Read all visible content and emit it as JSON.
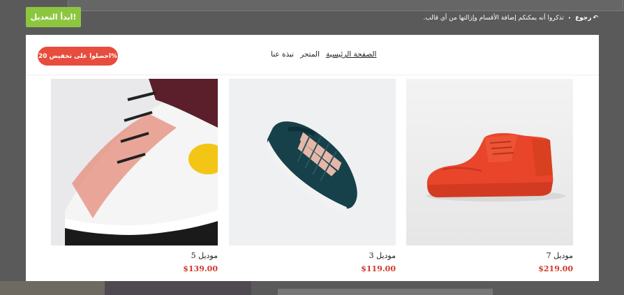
{
  "topbar": {
    "start_edit_label": "ابدأ التعديل!",
    "back_label": "رجوع",
    "note": "تذكروا أنه يمكنكم إضافة الأقسام وإزالتها من أي قالب."
  },
  "header": {
    "promo_label": "احصلوا على تخفيض 20%",
    "nav": [
      "الصفحة الرئيسية",
      "المتجر",
      "نبذة عنا"
    ]
  },
  "products": [
    {
      "title": "موديل 7",
      "price": "$219.00"
    },
    {
      "title": "موديل 3",
      "price": "$119.00"
    },
    {
      "title": "موديل 5",
      "price": "$139.00"
    }
  ],
  "colors": {
    "accent_green": "#8cc63f",
    "promo_red": "#e74c3c",
    "price_red": "#d0392b"
  }
}
